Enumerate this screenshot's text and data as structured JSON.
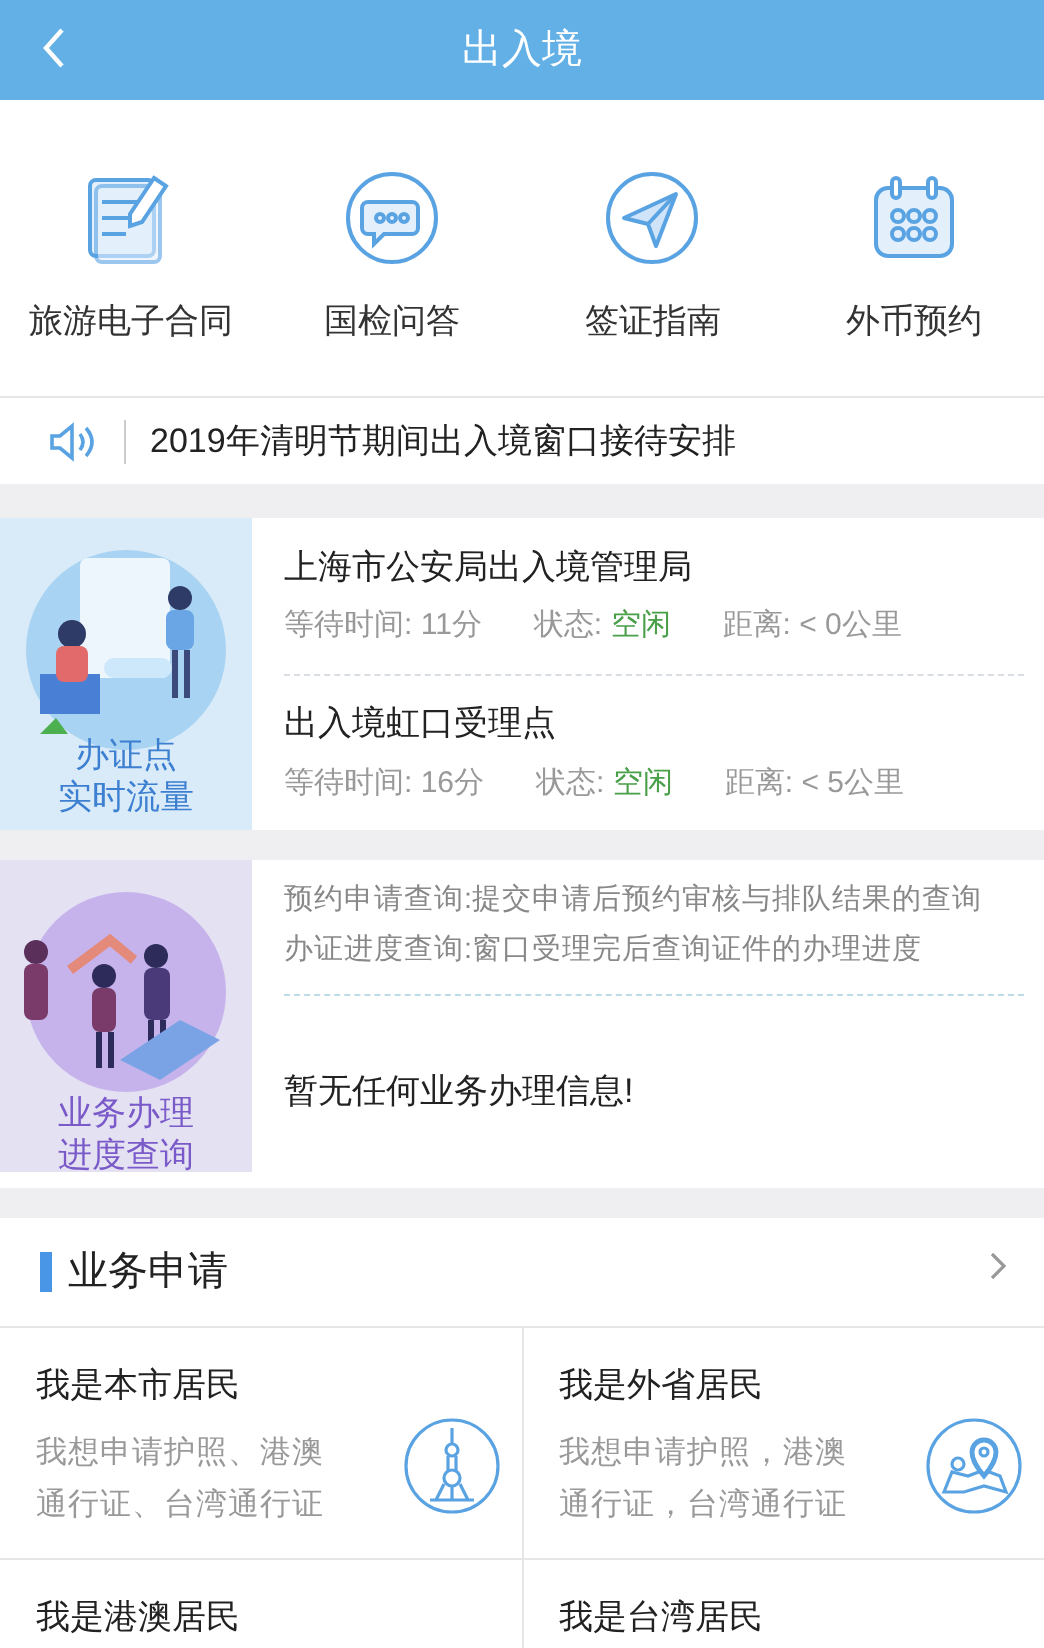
{
  "header": {
    "title": "出入境"
  },
  "shortcuts": [
    {
      "kind": "contract",
      "label": "旅游电子合同"
    },
    {
      "kind": "chat",
      "label": "国检问答"
    },
    {
      "kind": "plane",
      "label": "签证指南"
    },
    {
      "kind": "calendar",
      "label": "外币预约"
    }
  ],
  "notice": {
    "text": "2019年清明节期间出入境窗口接待安排"
  },
  "flow_card": {
    "label_lines": [
      "办证点",
      "实时流量"
    ],
    "stations": [
      {
        "name": "上海市公安局出入境管理局",
        "wait": "等待时间: 11分",
        "status_label": "状态:",
        "status": "空闲",
        "distance": "距离: < 0公里"
      },
      {
        "name": "出入境虹口受理点",
        "wait": "等待时间: 16分",
        "status_label": "状态:",
        "status": "空闲",
        "distance": "距离: < 5公里"
      }
    ]
  },
  "progress_card": {
    "label_lines": [
      "业务办理",
      "进度查询"
    ],
    "descriptions": [
      "预约申请查询:提交申请后预约审核与排队结果的查询",
      "办证进度查询:窗口受理完后查询证件的办理进度"
    ],
    "message": "暂无任何业务办理信息!"
  },
  "applications": {
    "title": "业务申请",
    "items": [
      {
        "title": "我是本市居民",
        "description": "我想申请护照、港澳通行证、台湾通行证",
        "kind": "tower"
      },
      {
        "title": "我是外省居民",
        "description": "我想申请护照，港澳通行证，台湾通行证",
        "kind": "map"
      },
      {
        "title": "我是港澳居民"
      },
      {
        "title": "我是台湾居民"
      }
    ]
  }
}
